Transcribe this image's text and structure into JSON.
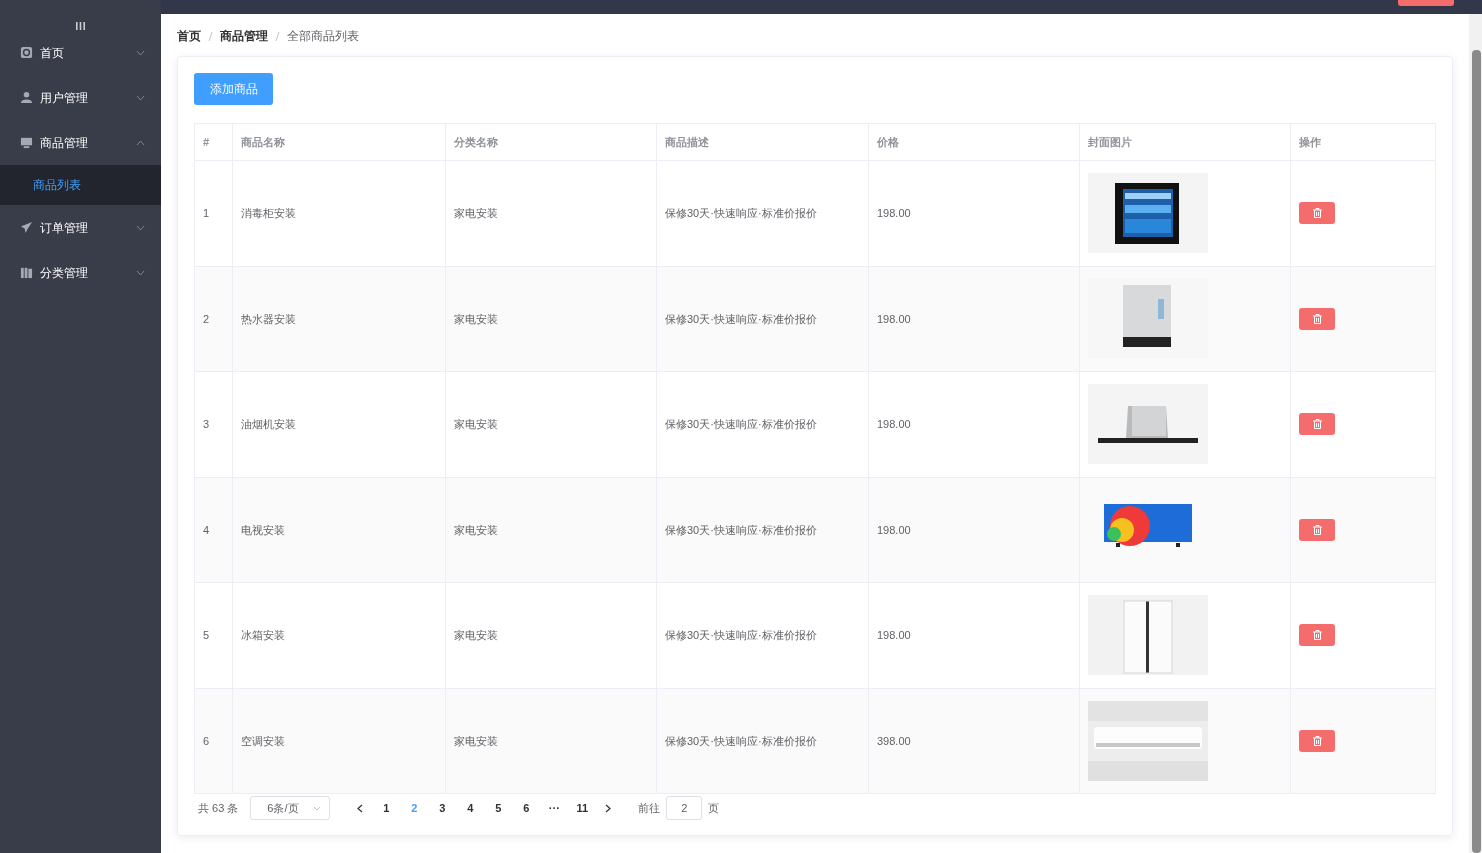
{
  "sidebar": {
    "items": [
      {
        "label": "首页",
        "expanded": false
      },
      {
        "label": "用户管理",
        "expanded": false
      },
      {
        "label": "商品管理",
        "expanded": true,
        "children": [
          {
            "label": "商品列表",
            "selected": true
          }
        ]
      },
      {
        "label": "订单管理",
        "expanded": false
      },
      {
        "label": "分类管理",
        "expanded": false
      }
    ]
  },
  "breadcrumb": [
    {
      "label": "首页",
      "current": false
    },
    {
      "label": "商品管理",
      "current": false
    },
    {
      "label": "全部商品列表",
      "current": true
    }
  ],
  "add_button": "添加商品",
  "table": {
    "columns": [
      "#",
      "商品名称",
      "分类名称",
      "商品描述",
      "价格",
      "封面图片",
      "操作"
    ],
    "rows": [
      {
        "index": "1",
        "name": "消毒柜安装",
        "category": "家电安装",
        "description": "保修30天·快速响应·标准价报价",
        "price": "198.00"
      },
      {
        "index": "2",
        "name": "热水器安装",
        "category": "家电安装",
        "description": "保修30天·快速响应·标准价报价",
        "price": "198.00"
      },
      {
        "index": "3",
        "name": "油烟机安装",
        "category": "家电安装",
        "description": "保修30天·快速响应·标准价报价",
        "price": "198.00"
      },
      {
        "index": "4",
        "name": "电视安装",
        "category": "家电安装",
        "description": "保修30天·快速响应·标准价报价",
        "price": "198.00"
      },
      {
        "index": "5",
        "name": "冰箱安装",
        "category": "家电安装",
        "description": "保修30天·快速响应·标准价报价",
        "price": "198.00"
      },
      {
        "index": "6",
        "name": "空调安装",
        "category": "家电安装",
        "description": "保修30天·快速响应·标准价报价",
        "price": "398.00"
      }
    ]
  },
  "pagination": {
    "total": "共 63 条",
    "page_size": "6条/页",
    "pages": [
      {
        "label": "1",
        "selected": false
      },
      {
        "label": "2",
        "selected": true
      },
      {
        "label": "3",
        "selected": false
      },
      {
        "label": "4",
        "selected": false
      },
      {
        "label": "5",
        "selected": false
      },
      {
        "label": "6",
        "selected": false
      },
      {
        "label": "···",
        "selected": false
      },
      {
        "label": "11",
        "selected": false
      }
    ],
    "goto_label": "前往",
    "goto_value": "2",
    "goto_suffix": "页"
  }
}
